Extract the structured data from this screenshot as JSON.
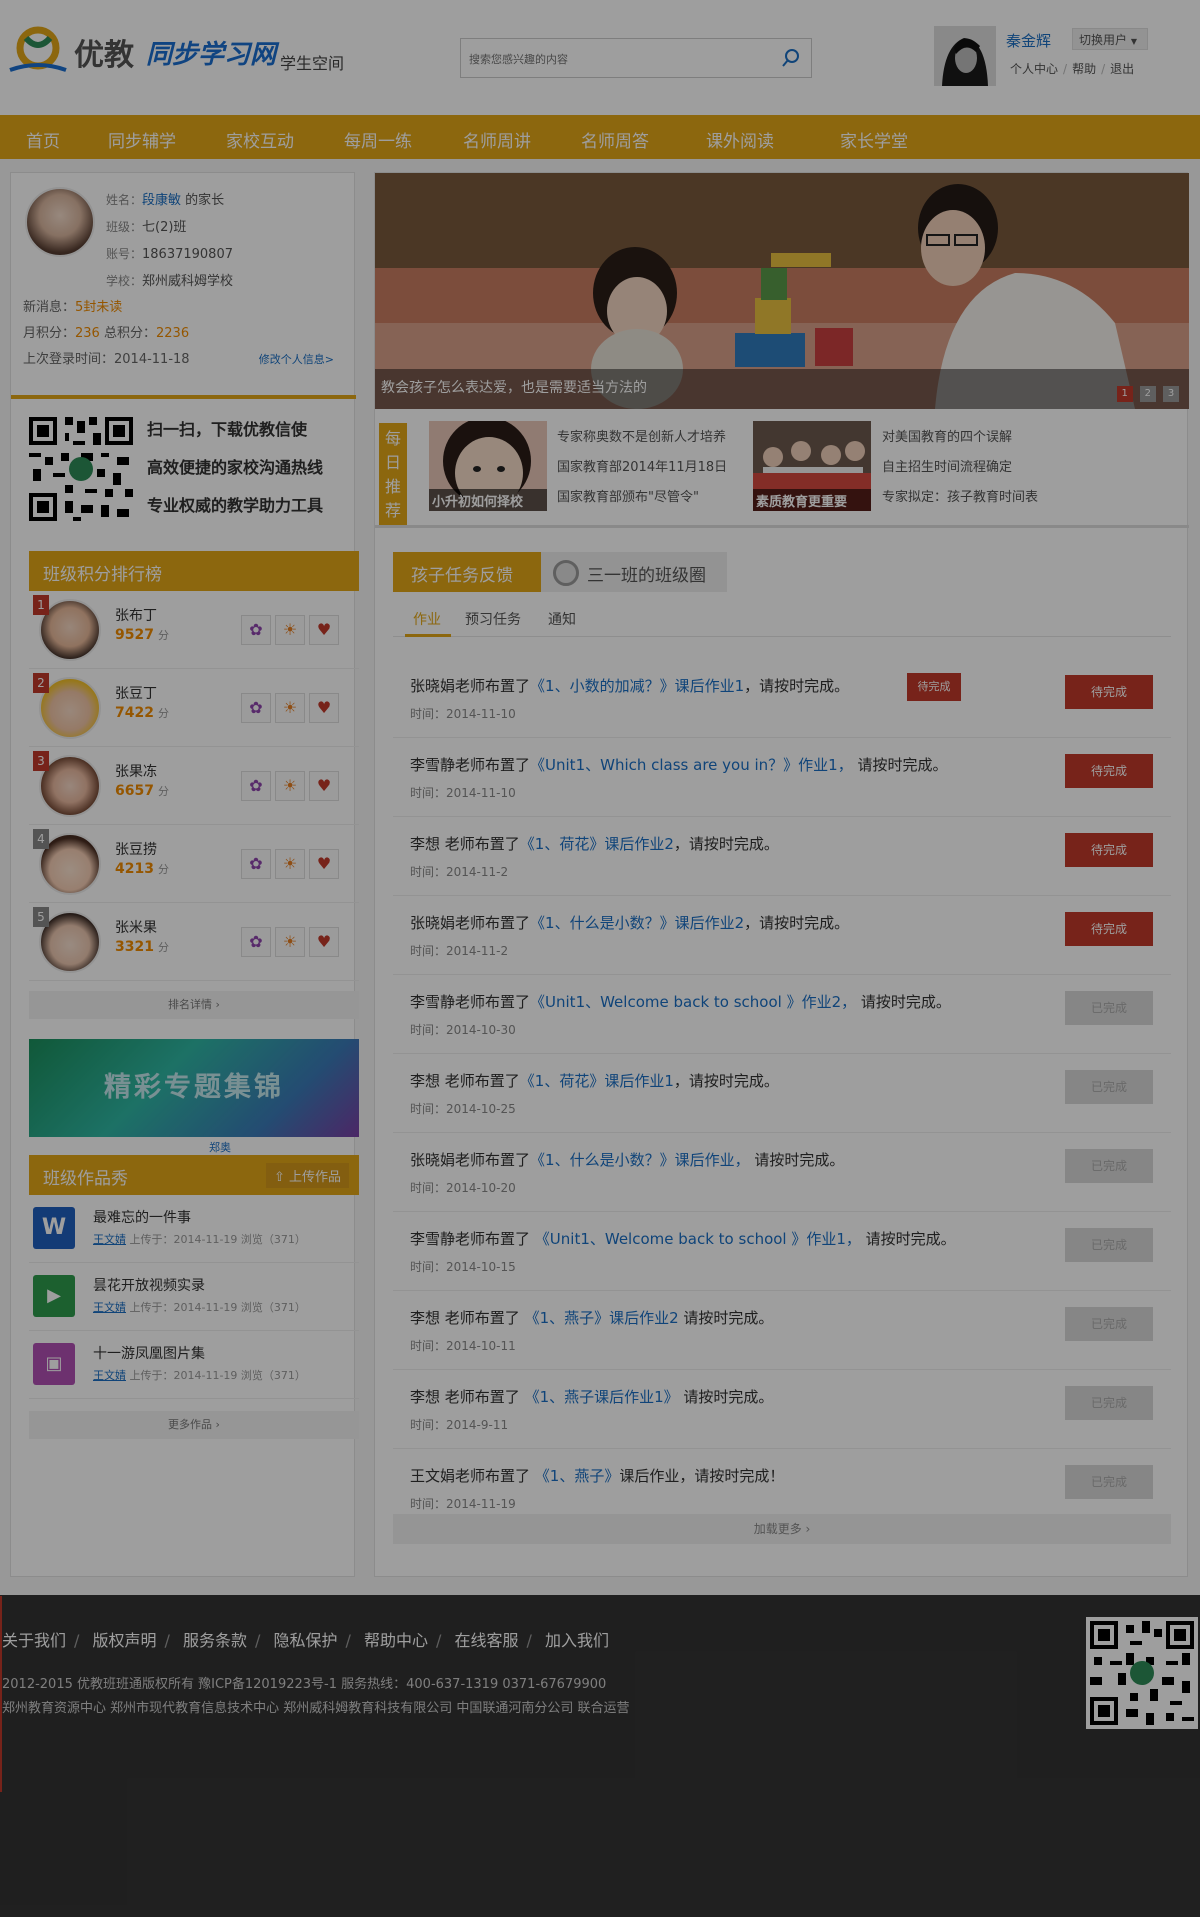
{
  "header": {
    "logo_text": "优教",
    "logo_sub": "同步学习网",
    "space": "学生空间",
    "search_placeholder": "搜索您感兴趣的内容",
    "user_name": "秦金辉",
    "switch_user": "切换用户",
    "links": [
      "个人中心",
      "帮助",
      "退出"
    ]
  },
  "nav": [
    "首页",
    "同步辅学",
    "家校互动",
    "每周一练",
    "名师周讲",
    "名师周答",
    "课外阅读",
    "家长学堂"
  ],
  "profile": {
    "name_label": "姓名：",
    "name": "段康敏",
    "role": "的家长",
    "class_label": "班级：",
    "class": "七(2)班",
    "account_label": "账号：",
    "account": "18637190807",
    "school_label": "学校：",
    "school": "郑州威科姆学校",
    "msg_label": "新消息：",
    "msg_value": "5封未读",
    "month_label": "月积分：",
    "month_value": "236",
    "total_label": "总积分：",
    "total_value": "2236",
    "last_label": "上次登录时间：",
    "last_value": "2014-11-18",
    "edit": "修改个人信息>"
  },
  "qr_promo": [
    "扫一扫，下载优教信使",
    "高效便捷的家校沟通热线",
    "专业权威的教学助力工具"
  ],
  "ranking": {
    "title": "班级积分排行榜",
    "unit": "分",
    "items": [
      {
        "rank": "1",
        "name": "张布丁",
        "score": "9527"
      },
      {
        "rank": "2",
        "name": "张豆丁",
        "score": "7422"
      },
      {
        "rank": "3",
        "name": "张果冻",
        "score": "6657"
      },
      {
        "rank": "4",
        "name": "张豆捞",
        "score": "4213"
      },
      {
        "rank": "5",
        "name": "张米果",
        "score": "3321"
      }
    ],
    "more": "排名详情  ›"
  },
  "banner": {
    "text": "精彩专题集锦",
    "caption": "郑奥"
  },
  "works": {
    "title": "班级作品秀",
    "upload": "上传作品",
    "items": [
      {
        "title": "最难忘的一件事",
        "author": "王文婧",
        "meta": " 上传于：2014-11-19   浏览（371）"
      },
      {
        "title": "昙花开放视频实录",
        "author": "王文婧",
        "meta": " 上传于：2014-11-19   浏览（371）"
      },
      {
        "title": "十一游凤凰图片集",
        "author": "王文婧",
        "meta": " 上传于：2014-11-19   浏览（371）"
      }
    ],
    "more": "更多作品  ›"
  },
  "hero": {
    "caption": "教会孩子怎么表达爱，也是需要适当方法的",
    "dots": [
      "1",
      "2",
      "3"
    ]
  },
  "daily": {
    "tag": "每日推荐",
    "img1_label": "小升初如何择校",
    "img2_label": "素质教育更重要",
    "list1": [
      "专家称奥数不是创新人才培养",
      "国家教育部2014年11月18日",
      "国家教育部颁布\"尽管令\""
    ],
    "list2": [
      "对美国教育的四个误解",
      "自主招生时间流程确定",
      "专家拟定：孩子教育时间表"
    ]
  },
  "tabs": {
    "active": "孩子任务反馈",
    "other": "三一班的班级圈"
  },
  "subtabs": [
    "作业",
    "预习任务",
    "通知"
  ],
  "tasks": [
    {
      "teacher": "张晓娟",
      "assign": "老师布置了",
      "link": "《1、小数的加减？》课后作业1",
      "suffix": "，请按时完成。",
      "time": "时间：2014-11-10",
      "status": "待完成",
      "tag": "待完成"
    },
    {
      "teacher": "李雪静",
      "assign": "老师布置了",
      "link": "《Unit1、Which  class are you in？》作业1，",
      "suffix": "  请按时完成。",
      "time": "时间：2014-11-10",
      "status": "待完成"
    },
    {
      "teacher": "李想",
      "assign": "   老师布置了",
      "link": "《1、荷花》课后作业2",
      "suffix": "，请按时完成。",
      "time": "时间：2014-11-2",
      "status": "待完成"
    },
    {
      "teacher": "张晓娟",
      "assign": "老师布置了",
      "link": "《1、什么是小数？》课后作业2",
      "suffix": "，请按时完成。",
      "time": "时间：2014-11-2",
      "status": "待完成"
    },
    {
      "teacher": "李雪静",
      "assign": "老师布置了",
      "link": "《Unit1、Welcome  back to school 》作业2，",
      "suffix": "  请按时完成。",
      "time": "时间：2014-10-30",
      "status": "已完成"
    },
    {
      "teacher": "李想",
      "assign": "   老师布置了",
      "link": "《1、荷花》课后作业1",
      "suffix": "，请按时完成。",
      "time": "时间：2014-10-25",
      "status": "已完成"
    },
    {
      "teacher": "张晓娟",
      "assign": "老师布置了",
      "link": "《1、什么是小数？》课后作业，",
      "suffix": "  请按时完成。",
      "time": "时间：2014-10-20",
      "status": "已完成"
    },
    {
      "teacher": "李雪静",
      "assign": "老师布置了",
      "link": " 《Unit1、Welcome  back to school 》作业1，",
      "suffix": "  请按时完成。",
      "time": "时间：2014-10-15",
      "status": "已完成"
    },
    {
      "teacher": "李想",
      "assign": "   老师布置了",
      "link": " 《1、燕子》课后作业2",
      "suffix": "  请按时完成。",
      "time": "时间：2014-10-11",
      "status": "已完成"
    },
    {
      "teacher": "李想",
      "assign": "   老师布置了",
      "link": " 《1、燕子课后作业1》",
      "suffix": "  请按时完成。",
      "time": "时间：2014-9-11",
      "status": "已完成"
    },
    {
      "teacher": "王文娟",
      "assign": "老师布置了",
      "link": " 《1、燕子》",
      "suffix": "课后作业，请按时完成！",
      "time": "时间：2014-11-19",
      "status": "已完成"
    }
  ],
  "load_more": "加载更多  ›",
  "footer": {
    "links": [
      "关于我们",
      "版权声明",
      "服务条款",
      "隐私保护",
      "帮助中心",
      "在线客服",
      "加入我们"
    ],
    "line1": "2012-2015 优教班班通版权所有  豫ICP备12019223号-1      服务热线：400-637-1319   0371-67679900",
    "line2": "郑州教育资源中心    郑州市现代教育信息技术中心    郑州威科姆教育科技有限公司 中国联通河南分公司  联合运营"
  }
}
